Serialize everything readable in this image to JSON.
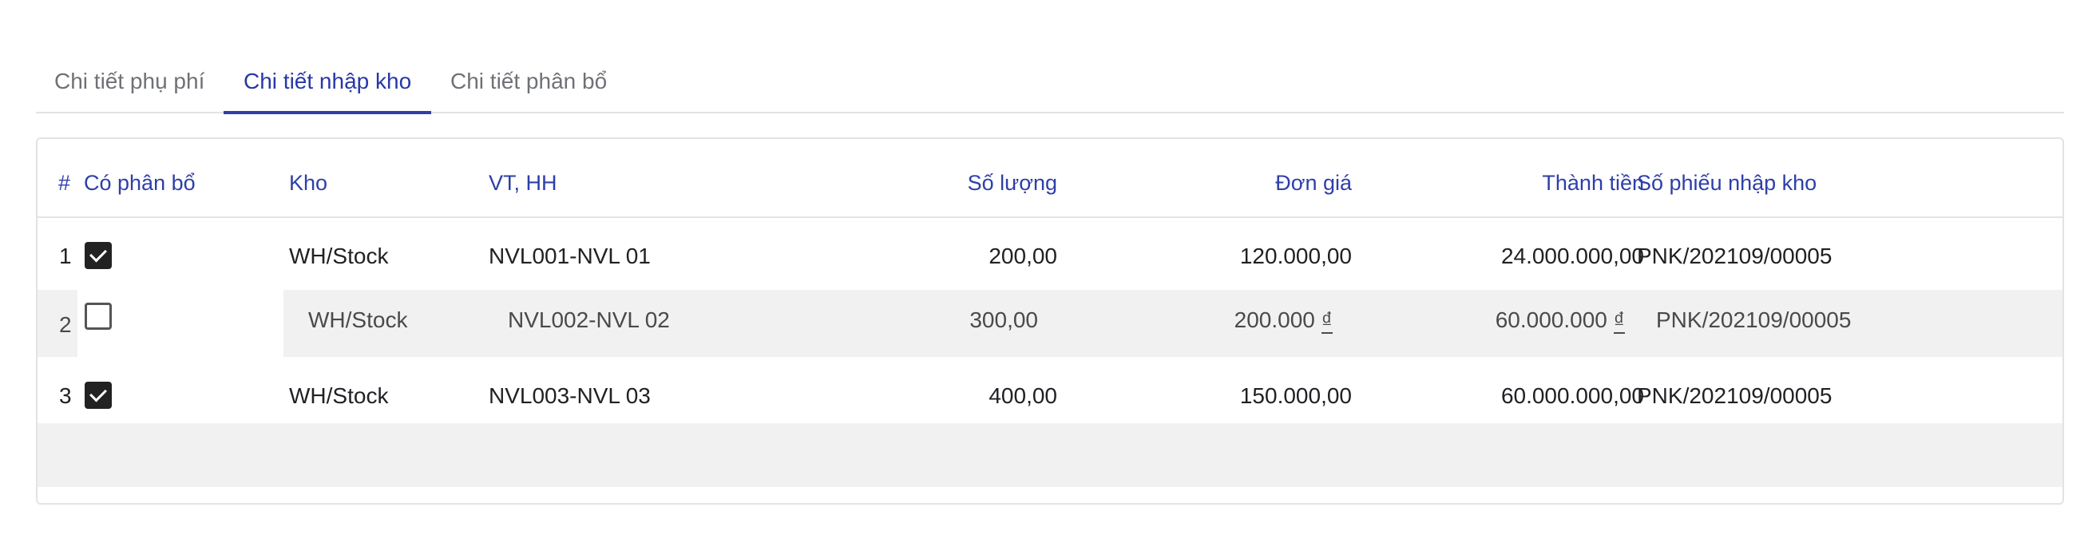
{
  "tabs": [
    {
      "label": "Chi tiết phụ phí",
      "active": false
    },
    {
      "label": "Chi tiết nhập kho",
      "active": true
    },
    {
      "label": "Chi tiết phân bổ",
      "active": false
    }
  ],
  "table": {
    "headers": {
      "index": "#",
      "allocated": "Có phân bổ",
      "warehouse": "Kho",
      "item": "VT, HH",
      "quantity": "Số lượng",
      "unit_price": "Đơn giá",
      "amount": "Thành tiền",
      "receipt_no": "Số phiếu nhập kho"
    },
    "rows": [
      {
        "index": "1",
        "allocated": true,
        "warehouse": "WH/Stock",
        "item": "NVL001-NVL 01",
        "quantity": "200,00",
        "unit_price": "120.000,00",
        "amount": "24.000.000,00",
        "receipt_no": "PNK/202109/00005"
      },
      {
        "index": "2",
        "allocated": false,
        "warehouse": "WH/Stock",
        "item": "NVL002-NVL 02",
        "quantity": "300,00",
        "unit_price": "200.000",
        "unit_price_currency": "₫",
        "amount": "60.000.000",
        "amount_currency": "₫",
        "receipt_no": "PNK/202109/00005"
      },
      {
        "index": "3",
        "allocated": true,
        "warehouse": "WH/Stock",
        "item": "NVL003-NVL 03",
        "quantity": "400,00",
        "unit_price": "150.000,00",
        "amount": "60.000.000,00",
        "receipt_no": "PNK/202109/00005"
      }
    ]
  },
  "colors": {
    "accent": "#2e3fa8",
    "tab_inactive": "#6f7177",
    "border": "#e2e3e6",
    "row_highlight": "#f1f1f1",
    "checkbox_checked": "#222222"
  },
  "icons": {
    "checked": "checkbox-checked-icon",
    "unchecked": "checkbox-unchecked-icon"
  }
}
